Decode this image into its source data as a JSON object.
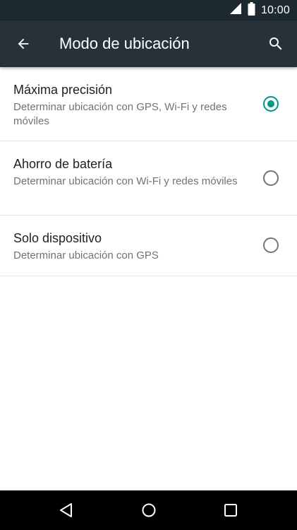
{
  "status_bar": {
    "time": "10:00",
    "signal_icon": "signal-icon",
    "battery_icon": "battery-icon"
  },
  "toolbar": {
    "title": "Modo de ubicación",
    "back_icon": "arrow-back-icon",
    "search_icon": "search-icon",
    "background": "#263238"
  },
  "options": [
    {
      "label": "Máxima precisión",
      "description": "Determinar ubicación con GPS, Wi-Fi y redes móviles",
      "selected": true
    },
    {
      "label": "Ahorro de batería",
      "description": "Determinar ubicación con Wi-Fi y redes móviles",
      "selected": false
    },
    {
      "label": "Solo dispositivo",
      "description": "Determinar ubicación con GPS",
      "selected": false
    }
  ],
  "colors": {
    "accent": "#009688",
    "status_bar": "#1c2a30",
    "nav_bar": "#000000"
  },
  "nav_bar": {
    "back_icon": "nav-back-icon",
    "home_icon": "nav-home-icon",
    "recents_icon": "nav-recents-icon"
  }
}
